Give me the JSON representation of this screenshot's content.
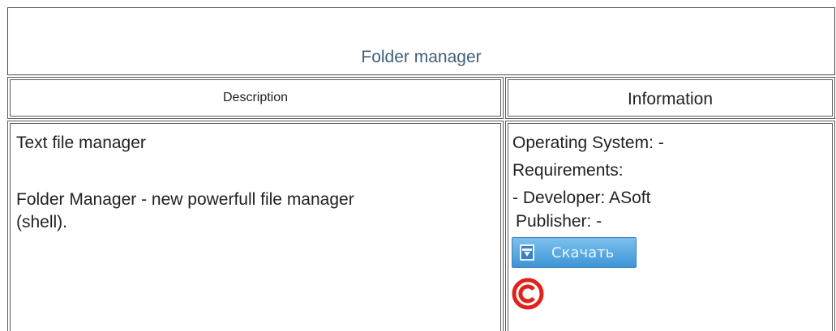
{
  "title": "Folder manager",
  "headers": {
    "description": "Description",
    "information": "Information"
  },
  "description": {
    "short": "Text file manager",
    "long_line1": "Folder Manager - new powerfull file manager",
    "long_line2": "(shell)."
  },
  "information": {
    "os": "Operating System: -",
    "requirements": "Requirements:",
    "developer": "- Developer: ASoft",
    "publisher": "Publisher: -"
  },
  "download_button": {
    "label": "Скачать",
    "icon": "download-icon"
  },
  "copyright_icon": "copyright-icon",
  "colors": {
    "title": "#3f5f7a",
    "button_top": "#7cc1ee",
    "button_bottom": "#3d95d6",
    "copyright": "#e0221b"
  }
}
